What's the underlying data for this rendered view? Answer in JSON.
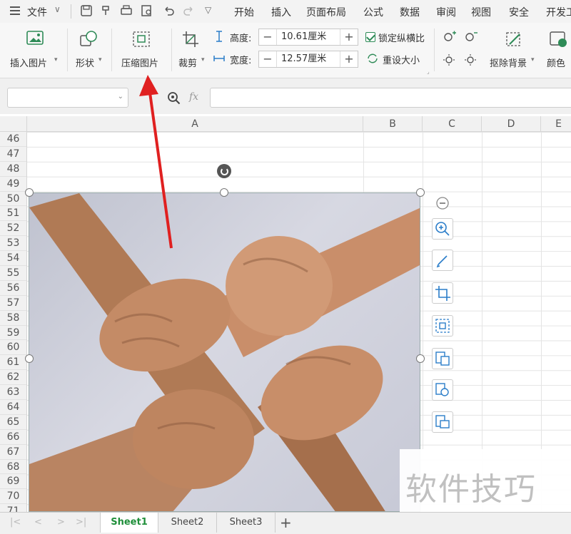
{
  "menubar": {
    "file": "文件",
    "tabs": [
      "开始",
      "插入",
      "页面布局",
      "公式",
      "数据",
      "审阅",
      "视图",
      "安全",
      "开发工"
    ]
  },
  "ribbon": {
    "insert_picture": "插入图片",
    "shape": "形状",
    "compress_picture": "压缩图片",
    "crop": "裁剪",
    "height_label": "高度:",
    "height_value": "10.61厘米",
    "width_label": "宽度:",
    "width_value": "12.57厘米",
    "lock_ratio": "锁定纵横比",
    "reset_size": "重设大小",
    "remove_bg": "抠除背景",
    "color": "颜色"
  },
  "formula": {
    "fx": "fx",
    "value": ""
  },
  "grid": {
    "columns": [
      "A",
      "B",
      "C",
      "D",
      "E"
    ],
    "rows": [
      "46",
      "47",
      "48",
      "49",
      "50",
      "51",
      "52",
      "53",
      "54",
      "55",
      "56",
      "57",
      "58",
      "59",
      "60",
      "61",
      "62",
      "63",
      "64",
      "65",
      "66",
      "67",
      "68",
      "69",
      "70",
      "71"
    ]
  },
  "sheets": [
    "Sheet1",
    "Sheet2",
    "Sheet3"
  ],
  "add_sheet": "+",
  "watermark": "软件技巧",
  "colors": {
    "accent_green": "#1f8f3a",
    "arrow_red": "#e02020"
  }
}
